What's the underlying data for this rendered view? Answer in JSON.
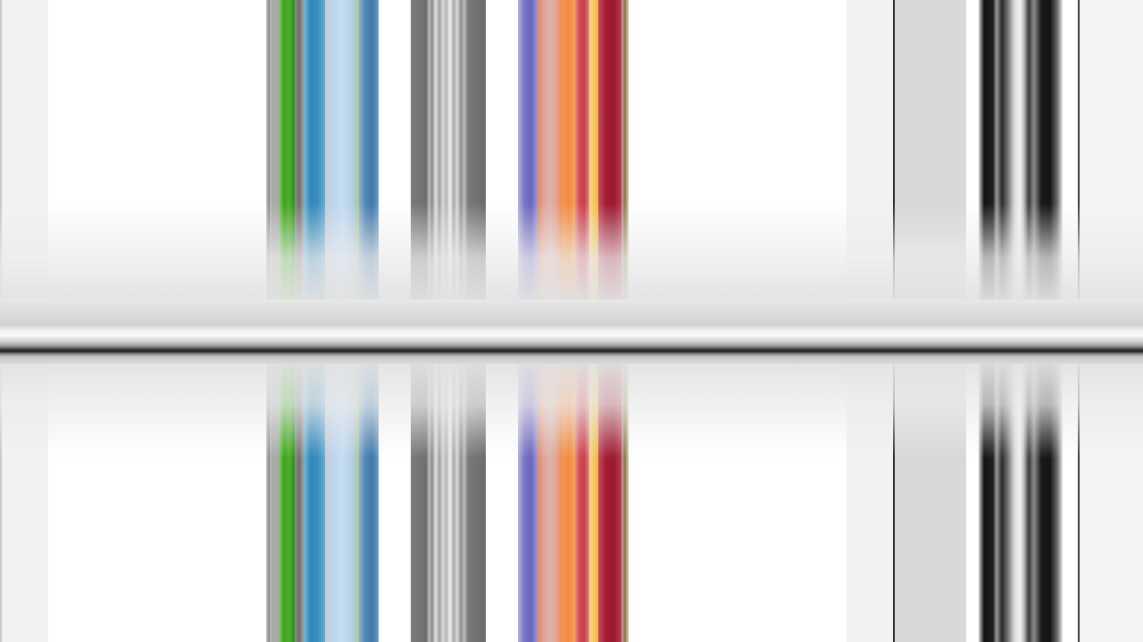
{
  "image_kind": "abstract vertical color-stripe pattern with horizontal reflection band",
  "palette": {
    "white": "#ffffff",
    "light_gray": "#f2f2f2",
    "mid_gray": "#d8d8d8",
    "dark_line": "#2a2a2a",
    "green": "#4caf2a",
    "teal_blue": "#3b8fbe",
    "pale_blue": "#bcd6ee",
    "steel_blue": "#4f86b5",
    "purple": "#7a74c6",
    "orange": "#f28a3a",
    "salmon": "#e4a497",
    "red": "#d04a52",
    "yellow": "#f4c85a",
    "crimson": "#a31d35",
    "black": "#151515"
  },
  "stripe_groups": [
    {
      "name": "left-edge",
      "colors": [
        "#f2f2f2"
      ]
    },
    {
      "name": "green-blue-group",
      "colors": [
        "#9c9c9c",
        "#4caf2a",
        "#7c7c7c",
        "#3b8fbe",
        "#bcd6ee",
        "#4f86b5"
      ]
    },
    {
      "name": "gray-group",
      "colors": [
        "#7a7a7a",
        "#b5b5b5",
        "#e0e0e0",
        "#9a9a9a",
        "#6f6f6f"
      ]
    },
    {
      "name": "warm-group",
      "colors": [
        "#7a74c6",
        "#e4a497",
        "#f28a3a",
        "#d04a52",
        "#f4c85a",
        "#a31d35"
      ]
    },
    {
      "name": "right-gray-group",
      "colors": [
        "#f2f2f2",
        "#d8d8d8"
      ]
    },
    {
      "name": "black-group",
      "colors": [
        "#151515",
        "#6a6a6a",
        "#2a2a2a"
      ]
    }
  ]
}
